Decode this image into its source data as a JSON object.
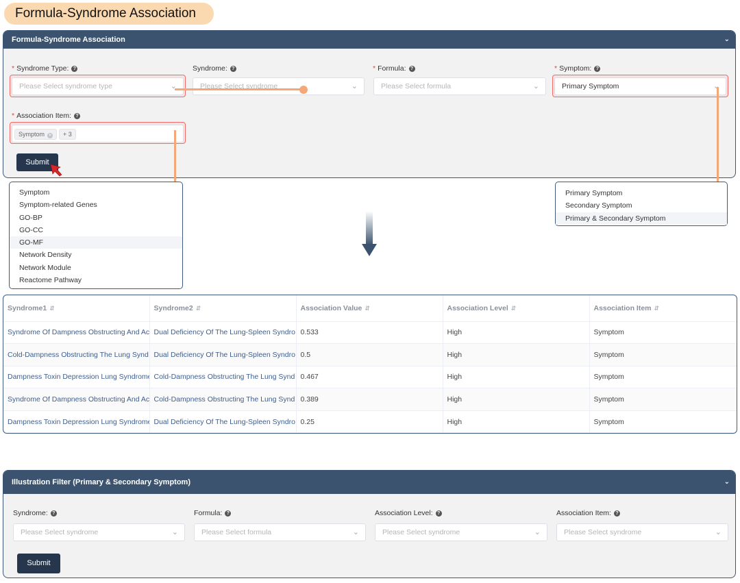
{
  "banner": {
    "title": "Formula-Syndrome Association"
  },
  "top_panel": {
    "title": "Formula-Syndrome Association",
    "fields": {
      "syndrome_type": {
        "label": "Syndrome Type:",
        "placeholder": "Please Select syndrome type"
      },
      "syndrome": {
        "label": "Syndrome:",
        "placeholder": "Please Select syndrome"
      },
      "formula": {
        "label": "Formula:",
        "placeholder": "Please Select formula"
      },
      "symptom": {
        "label": "Symptom:",
        "value": "Primary Symptom"
      },
      "association_item": {
        "label": "Association Item:",
        "tags": [
          "Symptom",
          "+ 3"
        ]
      }
    },
    "required_mark": "*",
    "submit_label": "Submit"
  },
  "association_item_options": [
    "Symptom",
    "Symptom-related Genes",
    "GO-BP",
    "GO-CC",
    "GO-MF",
    "Network Density",
    "Network Module",
    "Reactome Pathway"
  ],
  "symptom_options": [
    "Primary Symptom",
    "Secondary Symptom",
    "Primary & Secondary Symptom"
  ],
  "table": {
    "columns": [
      "Syndrome1",
      "Syndrome2",
      "Association Value",
      "Association Level",
      "Association Item"
    ],
    "rows": [
      [
        "Syndrome Of Dampness Obstructing And Ac",
        "Dual Deficiency Of The Lung-Spleen Syndro",
        "0.533",
        "High",
        "Symptom"
      ],
      [
        "Cold-Dampness Obstructing The Lung Synd",
        "Dual Deficiency Of The Lung-Spleen Syndro",
        "0.5",
        "High",
        "Symptom"
      ],
      [
        "Dampness Toxin Depression Lung Syndrome",
        "Cold-Dampness Obstructing The Lung Synd",
        "0.467",
        "High",
        "Symptom"
      ],
      [
        "Syndrome Of Dampness Obstructing And Ac",
        "Cold-Dampness Obstructing The Lung Synd",
        "0.389",
        "High",
        "Symptom"
      ],
      [
        "Dampness Toxin Depression Lung Syndrome",
        "Dual Deficiency Of The Lung-Spleen Syndro",
        "0.25",
        "High",
        "Symptom"
      ]
    ]
  },
  "bottom_panel": {
    "title": "Illustration Filter (Primary & Secondary Symptom)",
    "fields": {
      "syndrome": {
        "label": "Syndrome:",
        "placeholder": "Please Select syndrome"
      },
      "formula": {
        "label": "Formula:",
        "placeholder": "Please Select formula"
      },
      "association_level": {
        "label": "Association Level:",
        "placeholder": "Please Select syndrome"
      },
      "association_item": {
        "label": "Association Item:",
        "placeholder": "Please Select syndrome"
      }
    },
    "submit_label": "Submit"
  },
  "colors": {
    "header": "#3b536e",
    "button": "#25364d",
    "connector": "#f4a878",
    "highlight": "#f06a6a",
    "link": "#3d5e8e"
  }
}
